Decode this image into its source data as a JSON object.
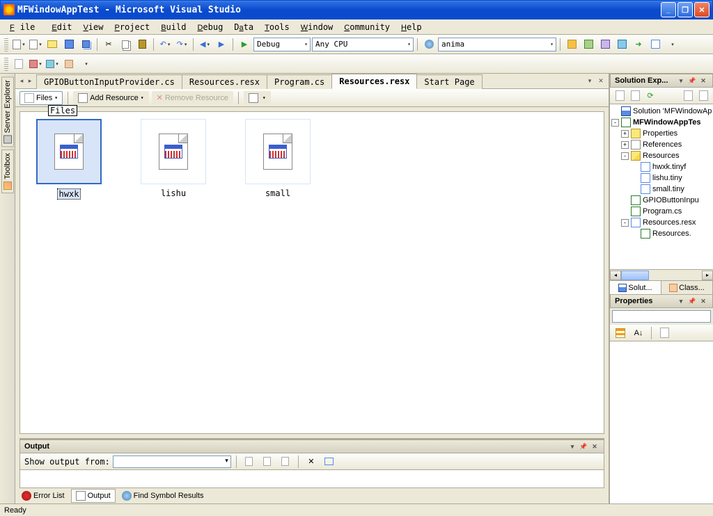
{
  "window": {
    "title": "MFWindowAppTest - Microsoft Visual Studio"
  },
  "menu": {
    "file": "File",
    "edit": "Edit",
    "view": "View",
    "project": "Project",
    "build": "Build",
    "debug": "Debug",
    "data": "Data",
    "tools": "Tools",
    "window": "Window",
    "community": "Community",
    "help": "Help"
  },
  "toolbar1": {
    "config": "Debug",
    "platform": "Any CPU",
    "find": "anima"
  },
  "left_tabs": {
    "server_explorer": "Server Explorer",
    "toolbox": "Toolbox"
  },
  "doc_tabs": [
    {
      "label": "GPIOButtonInputProvider.cs",
      "active": false
    },
    {
      "label": "Resources.resx",
      "active": false
    },
    {
      "label": "Program.cs",
      "active": false
    },
    {
      "label": "Resources.resx",
      "active": true
    },
    {
      "label": "Start Page",
      "active": false
    }
  ],
  "resource_toolbar": {
    "files_btn": "Files",
    "add_resource": "Add Resource",
    "remove_resource": "Remove Resource"
  },
  "resource_view": {
    "group_label": "Files",
    "items": [
      {
        "name": "hwxk",
        "selected": true
      },
      {
        "name": "lishu",
        "selected": false
      },
      {
        "name": "small",
        "selected": false
      }
    ]
  },
  "output": {
    "title": "Output",
    "show_from_label": "Show output from:",
    "selected_source": ""
  },
  "bottom_tabs": {
    "error_list": "Error List",
    "output": "Output",
    "find_results": "Find Symbol Results"
  },
  "solution_explorer": {
    "title": "Solution Exp...",
    "nodes": {
      "solution": "Solution 'MFWindowAp",
      "project": "MFWindowAppTes",
      "properties": "Properties",
      "references": "References",
      "resources_folder": "Resources",
      "hwxk": "hwxk.tinyf",
      "lishu": "lishu.tiny",
      "small": "small.tiny",
      "gpio": "GPIOButtonInpu",
      "program": "Program.cs",
      "resources_resx": "Resources.resx",
      "resources_designer": "Resources."
    },
    "tabs": {
      "solution": "Solut...",
      "class": "Class..."
    }
  },
  "properties": {
    "title": "Properties",
    "sort_az": "A↓"
  },
  "status": {
    "ready": "Ready"
  }
}
